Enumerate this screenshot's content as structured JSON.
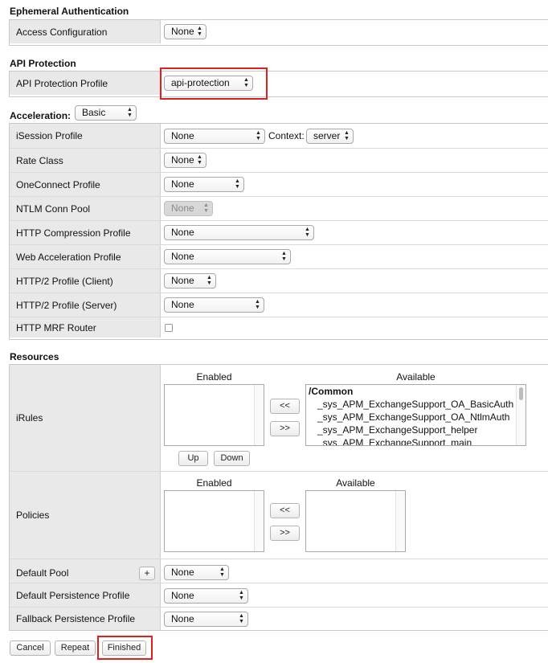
{
  "ephemeral": {
    "title": "Ephemeral Authentication",
    "access_label": "Access Configuration",
    "access_value": "None"
  },
  "api": {
    "title": "API Protection",
    "profile_label": "API Protection Profile",
    "profile_value": "api-protection"
  },
  "acceleration": {
    "title": "Acceleration:",
    "mode_value": "Basic",
    "rows": {
      "isession": {
        "label": "iSession Profile",
        "value": "None",
        "context_label": "Context:",
        "context_value": "server"
      },
      "rate_class": {
        "label": "Rate Class",
        "value": "None"
      },
      "oneconnect": {
        "label": "OneConnect Profile",
        "value": "None"
      },
      "ntlm": {
        "label": "NTLM Conn Pool",
        "value": "None"
      },
      "http_compression": {
        "label": "HTTP Compression Profile",
        "value": "None"
      },
      "web_acceleration": {
        "label": "Web Acceleration Profile",
        "value": "None"
      },
      "http2_client": {
        "label": "HTTP/2 Profile (Client)",
        "value": "None"
      },
      "http2_server": {
        "label": "HTTP/2 Profile (Server)",
        "value": "None"
      },
      "http_mrf": {
        "label": "HTTP MRF Router",
        "checked": false
      }
    }
  },
  "resources": {
    "title": "Resources",
    "irules": {
      "label": "iRules",
      "enabled_header": "Enabled",
      "available_header": "Available",
      "available_group": "/Common",
      "available_items": [
        "_sys_APM_ExchangeSupport_OA_BasicAuth",
        "_sys_APM_ExchangeSupport_OA_NtlmAuth",
        "_sys_APM_ExchangeSupport_helper",
        "_sys_APM_ExchangeSupport_main"
      ],
      "move_left": "<<",
      "move_right": ">>",
      "up": "Up",
      "down": "Down"
    },
    "policies": {
      "label": "Policies",
      "enabled_header": "Enabled",
      "available_header": "Available",
      "move_left": "<<",
      "move_right": ">>"
    },
    "default_pool": {
      "label": "Default Pool",
      "add": "+",
      "value": "None"
    },
    "default_persistence": {
      "label": "Default Persistence Profile",
      "value": "None"
    },
    "fallback_persistence": {
      "label": "Fallback Persistence Profile",
      "value": "None"
    }
  },
  "actions": {
    "cancel": "Cancel",
    "repeat": "Repeat",
    "finished": "Finished"
  },
  "colors": {
    "highlight": "#e0201c",
    "label_bg": "#e9e9e9"
  }
}
